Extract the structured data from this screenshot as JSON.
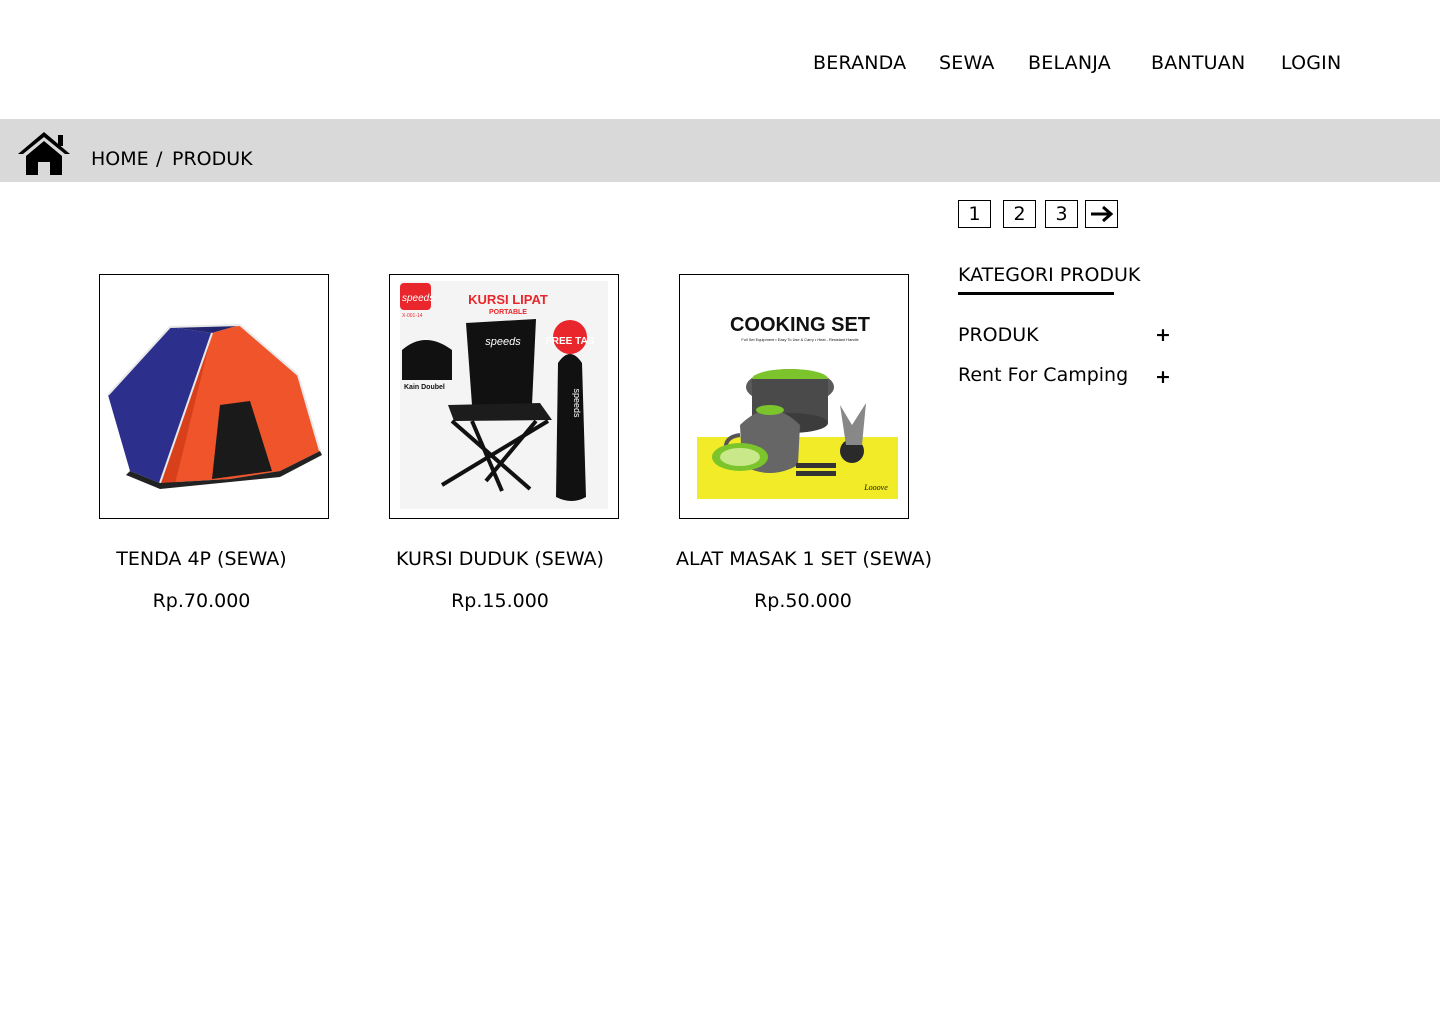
{
  "nav": {
    "items": [
      "BERANDA",
      "SEWA",
      "BELANJA",
      "BANTUAN",
      "LOGIN"
    ]
  },
  "breadcrumb": {
    "home": "HOME",
    "separator": "/",
    "current": "PRODUK"
  },
  "pagination": {
    "pages": [
      "1",
      "2",
      "3"
    ],
    "next_icon": "arrow-right-icon"
  },
  "products": [
    {
      "title": "TENDA 4P (SEWA)",
      "price": "Rp.70.000",
      "image": "tent-image"
    },
    {
      "title": "KURSI DUDUK (SEWA)",
      "price": "Rp.15.000",
      "image": "folding-chair-image",
      "image_text": {
        "heading": "KURSI LIPAT",
        "sub": "PORTABLE",
        "brand": "speeds",
        "model": "X-001-14",
        "badge": "FREE TAS",
        "note": "Kain Doubel"
      }
    },
    {
      "title": "ALAT MASAK 1 SET (SEWA)",
      "price": "Rp.50.000",
      "image": "cooking-set-image",
      "image_text": {
        "heading": "COOKING SET",
        "sub": "Full Set Equipment • Easy To Use & Carry • Heat - Resistant Handle",
        "brand": "Looove"
      }
    }
  ],
  "sidebar": {
    "title": "KATEGORI PRODUK",
    "categories": [
      {
        "label": "PRODUK",
        "toggle": "+"
      },
      {
        "label": "Rent For Camping",
        "toggle": "+"
      }
    ]
  },
  "colors": {
    "crumb_bar": "#d9d9d9",
    "tent_blue": "#2c2f8c",
    "tent_orange": "#f0542a",
    "cook_yellow": "#f2ec28",
    "cook_green": "#7cc42b"
  }
}
